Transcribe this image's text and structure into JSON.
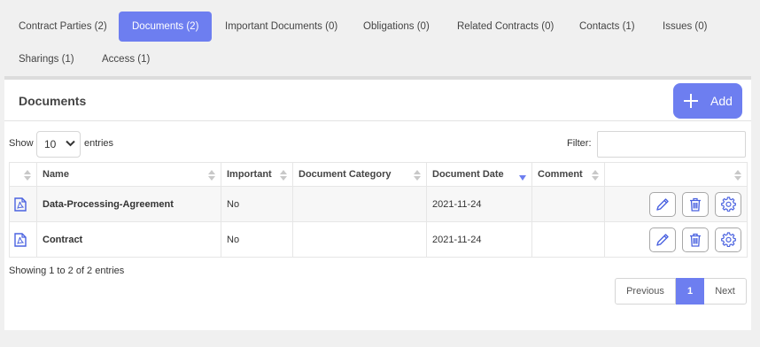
{
  "tabs": [
    {
      "label": "Contract Parties (2)",
      "active": false
    },
    {
      "label": "Documents (2)",
      "active": true
    },
    {
      "label": "Important Documents (0)",
      "active": false
    },
    {
      "label": "Obligations (0)",
      "active": false
    },
    {
      "label": "Related Contracts (0)",
      "active": false
    },
    {
      "label": "Contacts (1)",
      "active": false
    },
    {
      "label": "Issues (0)",
      "active": false
    },
    {
      "label": "Sharings (1)",
      "active": false
    },
    {
      "label": "Access (1)",
      "active": false
    }
  ],
  "panel": {
    "title": "Documents",
    "add_label": "Add"
  },
  "controls": {
    "show_label": "Show",
    "entries_value": "10",
    "entries_label": "entries",
    "filter_label": "Filter:",
    "filter_value": ""
  },
  "table": {
    "columns": [
      "",
      "Name",
      "Important",
      "Document Category",
      "Document Date",
      "Comment",
      ""
    ],
    "sorted_column": "Document Date",
    "sort_direction": "desc",
    "rows": [
      {
        "name": "Data-Processing-Agreement",
        "important": "No",
        "category": "",
        "date": "2021-11-24",
        "comment": ""
      },
      {
        "name": "Contract",
        "important": "No",
        "category": "",
        "date": "2021-11-24",
        "comment": ""
      }
    ]
  },
  "footer": {
    "info": "Showing 1 to 2 of 2 entries",
    "prev_label": "Previous",
    "current_page": "1",
    "next_label": "Next"
  },
  "icons": {
    "file_type": "pdf-file-icon",
    "edit": "pencil-icon",
    "delete": "trash-icon",
    "settings": "gear-icon",
    "add": "plus-icon"
  },
  "colors": {
    "accent": "#6d7ef0",
    "icon_blue": "#4a62e0"
  }
}
